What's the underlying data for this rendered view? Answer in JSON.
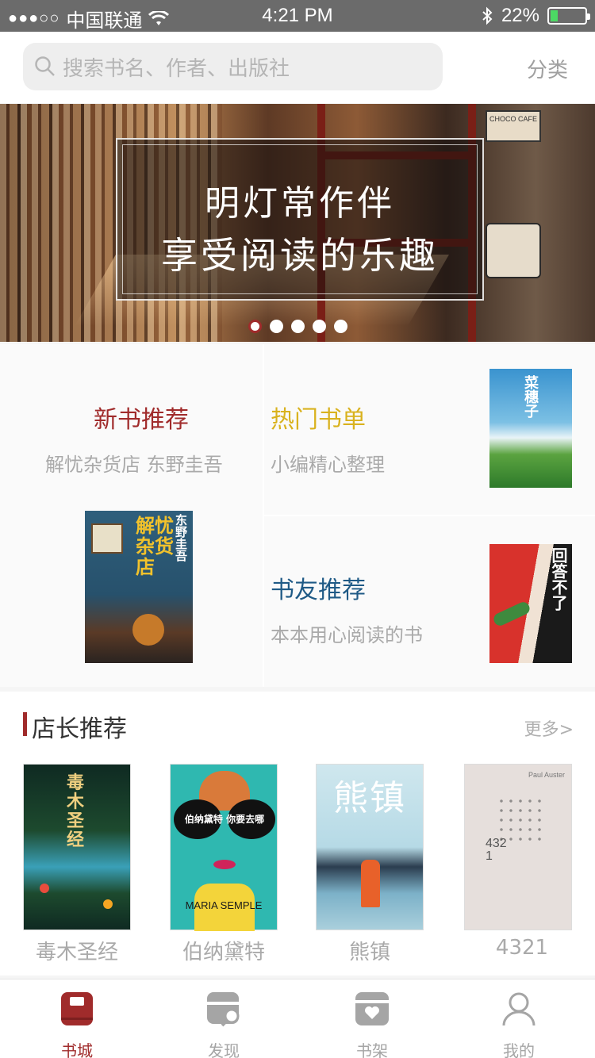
{
  "status_bar": {
    "signal": "●●●○○",
    "carrier": "中国联通",
    "time": "4:21 PM",
    "battery": "22%",
    "battery_level": 0.22
  },
  "search": {
    "placeholder": "搜索书名、作者、出版社",
    "category_label": "分类"
  },
  "banner": {
    "line1": "明灯常作伴",
    "line2": "享受阅读的乐趣",
    "slide_count": 5,
    "active_index": 0,
    "cafe_sign": "CHOCO CAFE"
  },
  "sections": {
    "new_books": {
      "title": "新书推荐",
      "subtitle": "解忧杂货店 东野圭吾",
      "color": "#a02b2b",
      "cover": {
        "title": "解忧杂货店",
        "author": "东野圭吾"
      }
    },
    "hot_lists": {
      "title": "热门书单",
      "subtitle": "小编精心整理",
      "color": "#d9b21e",
      "cover": {
        "title": "菜穗子"
      }
    },
    "friends": {
      "title": "书友推荐",
      "subtitle": "本本用心阅读的书",
      "color": "#1f5a86",
      "cover": {
        "title": "回答不了"
      }
    }
  },
  "shop": {
    "title": "店长推荐",
    "more": "更多>",
    "books": [
      {
        "name": "毒木圣经",
        "cover_text": "毒木圣经"
      },
      {
        "name": "伯纳黛特",
        "cover_text": "伯纳黛特 你要去哪",
        "cover_sub": "MARIA SEMPLE"
      },
      {
        "name": "熊镇",
        "cover_text": "熊镇"
      },
      {
        "name": "4321",
        "cover_text": "4321",
        "cover_sub": "Paul Auster"
      }
    ]
  },
  "tabbar": {
    "items": [
      {
        "label": "书城",
        "icon": "bookstore-icon",
        "active": true
      },
      {
        "label": "发现",
        "icon": "discover-icon",
        "active": false
      },
      {
        "label": "书架",
        "icon": "bookshelf-icon",
        "active": false
      },
      {
        "label": "我的",
        "icon": "profile-icon",
        "active": false
      }
    ],
    "active_color": "#a02b2b",
    "inactive_color": "#a5a5a5"
  }
}
